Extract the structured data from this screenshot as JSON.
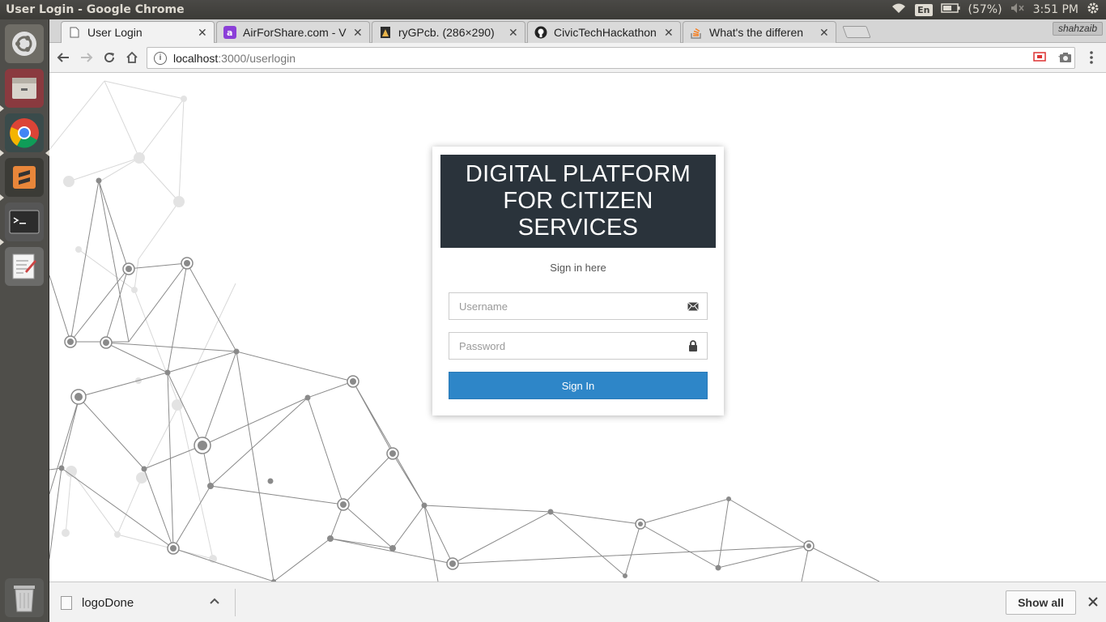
{
  "system": {
    "window_title": "User Login - Google Chrome",
    "battery": "(57%)",
    "time": "3:51 PM",
    "keyboard_layout": "En",
    "icons": [
      "wifi-icon",
      "battery-icon",
      "mute-icon",
      "settings-gear-icon"
    ]
  },
  "launcher": {
    "items": [
      "ubuntu-dash",
      "files",
      "chrome",
      "sublime-text",
      "terminal",
      "text-editor",
      "trash"
    ]
  },
  "browser": {
    "tabs": [
      {
        "label": "User Login",
        "active": true
      },
      {
        "label": "AirForShare.com - V",
        "active": false
      },
      {
        "label": "ryGPcb. (286×290)",
        "active": false
      },
      {
        "label": "CivicTechHackathon",
        "active": false
      },
      {
        "label": "What's the differen",
        "active": false
      }
    ],
    "profile_name": "shahzaib",
    "url_host": "localhost",
    "url_path": ":3000/userlogin"
  },
  "login": {
    "title": "DIGITAL PLATFORM FOR CITIZEN SERVICES",
    "subtitle": "Sign in here",
    "username_placeholder": "Username",
    "password_placeholder": "Password",
    "submit_label": "Sign In"
  },
  "downloads": {
    "file_name": "logoDone",
    "show_all_label": "Show all"
  },
  "colors": {
    "header_bg": "#2a333b",
    "button_bg": "#2e86c8",
    "panel_bg": "#3c3b37",
    "network_line": "#8a8a8a"
  }
}
